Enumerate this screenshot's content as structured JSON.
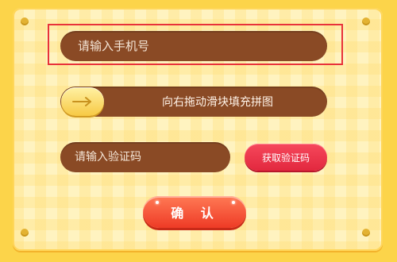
{
  "form": {
    "phone_placeholder": "请输入手机号",
    "slider_label": "向右拖动滑块填充拼图",
    "code_placeholder": "请输入验证码",
    "get_code_label": "获取验证码",
    "confirm_label": "确 认"
  },
  "icons": {
    "slider_knob": "arrow-right-icon"
  },
  "colors": {
    "background": "#fcd44a",
    "input_fill": "#8a4a25",
    "primary_red": "#e2283e",
    "confirm_orange": "#ee3b26",
    "highlight_border": "#e8323a"
  }
}
